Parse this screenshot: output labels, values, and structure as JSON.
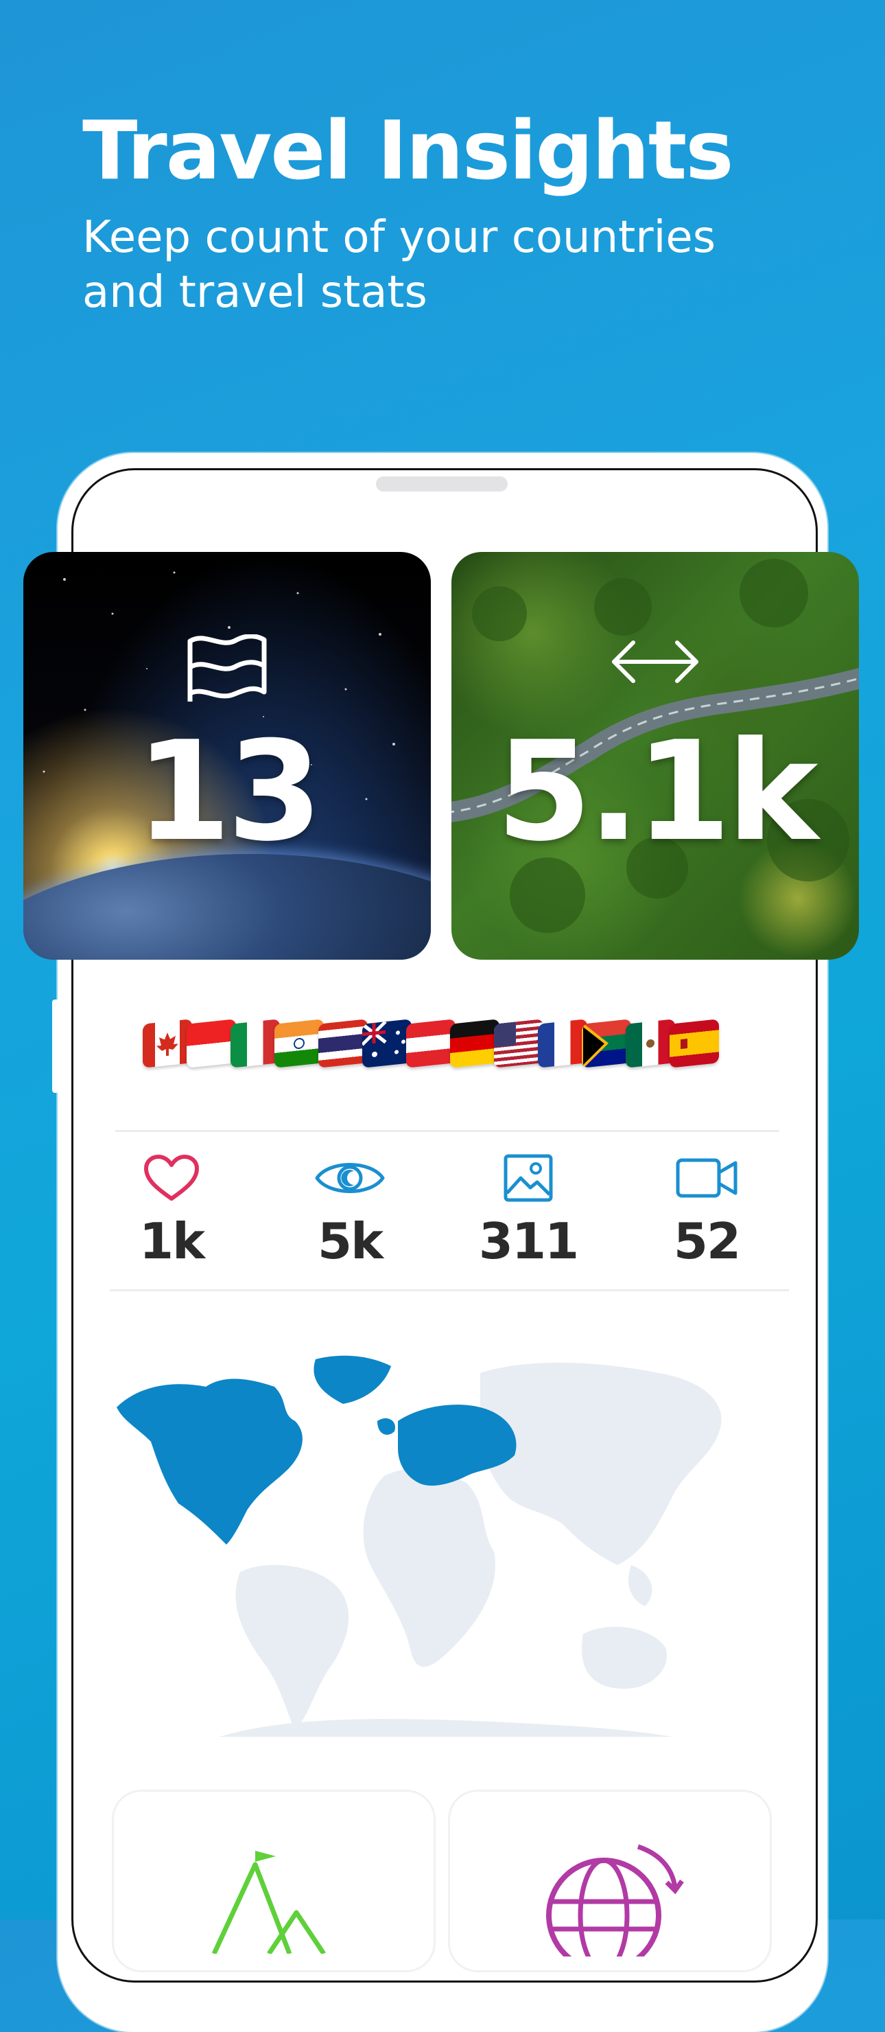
{
  "header": {
    "title": "Travel Insights",
    "subtitle": "Keep count of your countries\nand travel stats"
  },
  "cards": {
    "countries": {
      "icon": "flag-icon",
      "value": "13"
    },
    "distance": {
      "icon": "double-arrow-icon",
      "value": "5.1k"
    }
  },
  "flags": [
    "Canada",
    "Indonesia",
    "Italy",
    "India",
    "Thailand",
    "Australia",
    "Austria",
    "Germany",
    "United States",
    "France",
    "South Africa",
    "Mexico",
    "Spain"
  ],
  "stats": [
    {
      "icon": "heart-icon",
      "value": "1k",
      "color": "#e0305f"
    },
    {
      "icon": "eye-icon",
      "value": "5k",
      "color": "#1a8fd0"
    },
    {
      "icon": "image-icon",
      "value": "311",
      "color": "#1a8fd0"
    },
    {
      "icon": "video-icon",
      "value": "52",
      "color": "#1a8fd0"
    }
  ],
  "map": {
    "visited_color": "#0c86c6",
    "unvisited_color": "#e8edf3"
  },
  "bottom_cards": [
    {
      "icon": "mountain-flag-icon",
      "color": "#5fd03a"
    },
    {
      "icon": "globe-refresh-icon",
      "color": "#b23aa5"
    }
  ]
}
